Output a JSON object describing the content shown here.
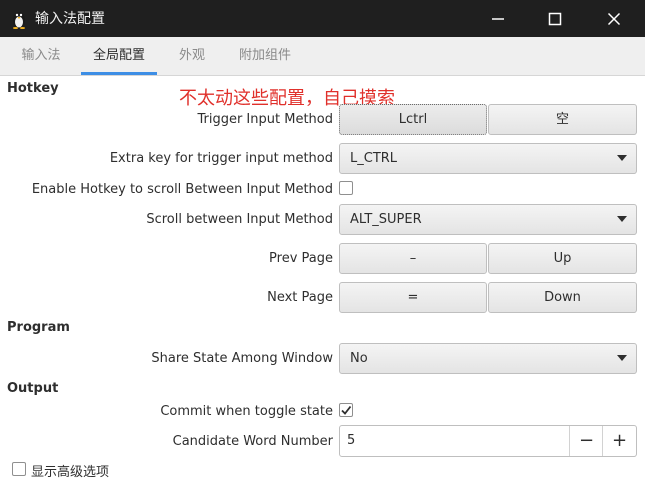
{
  "window": {
    "title": "输入法配置",
    "controls": [
      "minimize",
      "maximize",
      "close"
    ]
  },
  "tabs": [
    {
      "label": "输入法",
      "active": false
    },
    {
      "label": "全局配置",
      "active": true
    },
    {
      "label": "外观",
      "active": false
    },
    {
      "label": "附加组件",
      "active": false
    }
  ],
  "annotation": "不太动这些配置，自己摸索",
  "sections": {
    "hotkey": "Hotkey",
    "program": "Program",
    "output": "Output"
  },
  "hotkey": {
    "trigger": {
      "label": "Trigger Input Method",
      "key1": "Lctrl",
      "key2": "空"
    },
    "extra": {
      "label": "Extra key for trigger input method",
      "value": "L_CTRL"
    },
    "enable_scroll": {
      "label": "Enable Hotkey to scroll Between Input Method",
      "checked": false
    },
    "scroll": {
      "label": "Scroll between Input Method",
      "value": "ALT_SUPER"
    },
    "prev_page": {
      "label": "Prev Page",
      "key1": "–",
      "key2": "Up"
    },
    "next_page": {
      "label": "Next Page",
      "key1": "=",
      "key2": "Down"
    }
  },
  "program": {
    "share_state": {
      "label": "Share State Among Window",
      "value": "No"
    }
  },
  "output": {
    "commit_toggle": {
      "label": "Commit when toggle state",
      "checked": true
    },
    "candidate": {
      "label": "Candidate Word Number",
      "value": "5",
      "minus": "−",
      "plus": "+"
    }
  },
  "advanced": {
    "label": "显示高级选项",
    "checked": false
  },
  "colors": {
    "titlebar": "#1f1f1f",
    "tab_accent": "#3d8ee5",
    "annotation": "#e0302b"
  }
}
